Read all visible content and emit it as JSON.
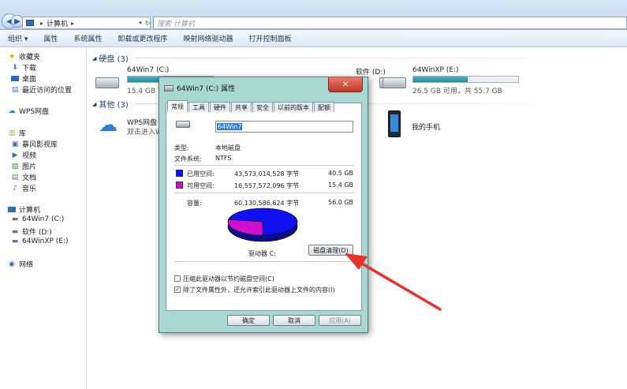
{
  "address": {
    "location": "计算机",
    "search_placeholder": "搜索 计算机"
  },
  "toolbar": [
    "组织 ▾",
    "属性",
    "系统属性",
    "卸载或更改程序",
    "映射网络驱动器",
    "打开控制面板"
  ],
  "sidebar": {
    "favorites": "收藏夹",
    "fav_items": [
      "下载",
      "桌面",
      "最近访问的位置"
    ],
    "wps": "WPS网盘",
    "library": "库",
    "lib_items": [
      "暴风影视库",
      "视频",
      "图片",
      "文档",
      "音乐"
    ],
    "computer": "计算机",
    "drives": [
      "64Win7  (C:)",
      "软件 (D:)",
      "64WinXP  (E:)"
    ],
    "network": "网络"
  },
  "main": {
    "group_disks": "硬盘 (3)",
    "group_other": "其他 (3)",
    "drive_c": {
      "name": "64Win7  (C:)",
      "stat": "15.4 GB 可",
      "used": 0.72
    },
    "drive_d": {
      "name": "软件 (D:)"
    },
    "drive_e": {
      "name": "64WinXP  (E:)",
      "stat": "26.5 GB 可用，共 55.7 GB",
      "used": 0.52
    },
    "wps_name": "WPS网盘",
    "wps_desc": "双击进入W",
    "phone": "我的手机"
  },
  "dialog": {
    "title": "64Win7  (C:) 属性",
    "close": "✕",
    "tabs": [
      "常规",
      "工具",
      "硬件",
      "共享",
      "安全",
      "以前的版本",
      "配额"
    ],
    "name_value": "64Win7",
    "type_label": "类型:",
    "type_value": "本地磁盘",
    "fs_label": "文件系统:",
    "fs_value": "NTFS",
    "used_label": "已用空间:",
    "used_bytes": "43,573,014,528 字节",
    "used_gb": "40.5 GB",
    "free_label": "可用空间:",
    "free_bytes": "16,557,572,096 字节",
    "free_gb": "15.4 GB",
    "cap_label": "容量:",
    "cap_bytes": "60,130,586,624 字节",
    "cap_gb": "56.0 GB",
    "drive_label": "驱动器 C:",
    "cleanup_btn": "磁盘清理(D)",
    "compress_label": "压缩此驱动器以节约磁盘空间(C)",
    "index_label": "除了文件属性外，还允许索引此驱动器上文件的内容(I)",
    "ok": "确定",
    "cancel": "取消",
    "apply": "应用(A)",
    "colors": {
      "used": "#1010f0",
      "free": "#d010d0"
    }
  }
}
